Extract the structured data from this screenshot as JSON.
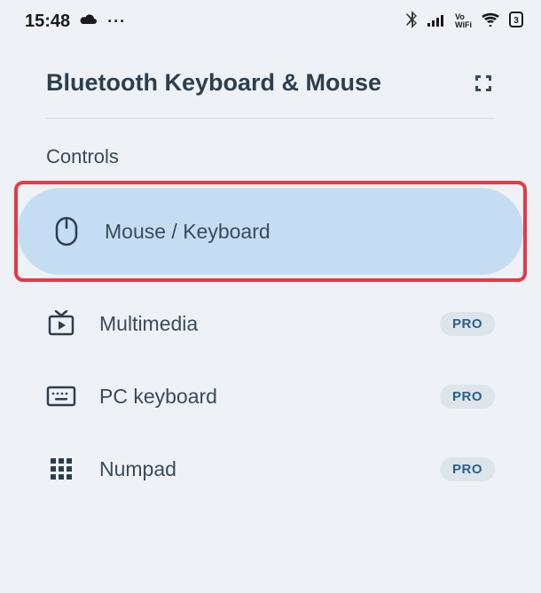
{
  "status": {
    "time": "15:48",
    "icons": [
      "cloud",
      "more",
      "bluetooth",
      "signal",
      "vowifi",
      "wifi",
      "battery"
    ]
  },
  "header": {
    "title": "Bluetooth Keyboard & Mouse"
  },
  "section": {
    "title": "Controls"
  },
  "controls": [
    {
      "label": "Mouse / Keyboard",
      "icon": "mouse",
      "pro": false,
      "selected": true,
      "highlighted": true
    },
    {
      "label": "Multimedia",
      "icon": "tv-play",
      "pro": true,
      "selected": false
    },
    {
      "label": "PC keyboard",
      "icon": "keyboard",
      "pro": true,
      "selected": false
    },
    {
      "label": "Numpad",
      "icon": "grid",
      "pro": true,
      "selected": false
    }
  ],
  "badge": {
    "pro_label": "PRO"
  }
}
